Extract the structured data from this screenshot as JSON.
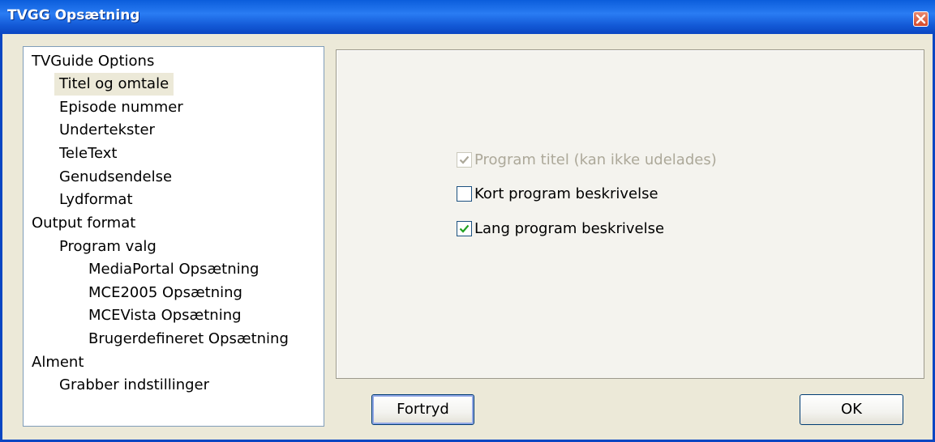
{
  "window": {
    "title": "TVGG Opsætning",
    "title_color": "#0a46c2"
  },
  "tree": {
    "items": [
      {
        "label": "TVGuide Options",
        "level": 0,
        "selected": false
      },
      {
        "label": "Titel og omtale",
        "level": 1,
        "selected": true
      },
      {
        "label": "Episode nummer",
        "level": 1,
        "selected": false
      },
      {
        "label": "Undertekster",
        "level": 1,
        "selected": false
      },
      {
        "label": "TeleText",
        "level": 1,
        "selected": false
      },
      {
        "label": "Genudsendelse",
        "level": 1,
        "selected": false
      },
      {
        "label": "Lydformat",
        "level": 1,
        "selected": false
      },
      {
        "label": "Output format",
        "level": 0,
        "selected": false
      },
      {
        "label": "Program valg",
        "level": 1,
        "selected": false
      },
      {
        "label": "MediaPortal Opsætning",
        "level": 2,
        "selected": false
      },
      {
        "label": "MCE2005 Opsætning",
        "level": 2,
        "selected": false
      },
      {
        "label": "MCEVista Opsætning",
        "level": 2,
        "selected": false
      },
      {
        "label": "Brugerdefineret Opsætning",
        "level": 2,
        "selected": false
      },
      {
        "label": "Alment",
        "level": 0,
        "selected": false
      },
      {
        "label": "Grabber indstillinger",
        "level": 1,
        "selected": false
      }
    ]
  },
  "options": {
    "program_title": {
      "label": "Program titel (kan ikke udelades)",
      "checked": true,
      "disabled": true
    },
    "short_description": {
      "label": "Kort program beskrivelse",
      "checked": false,
      "disabled": false
    },
    "long_description": {
      "label": "Lang program beskrivelse",
      "checked": true,
      "disabled": false
    }
  },
  "buttons": {
    "cancel_label": "Fortryd",
    "ok_label": "OK"
  },
  "colors": {
    "checkmark": "#21a121",
    "checkmark_disabled": "#aca899"
  }
}
